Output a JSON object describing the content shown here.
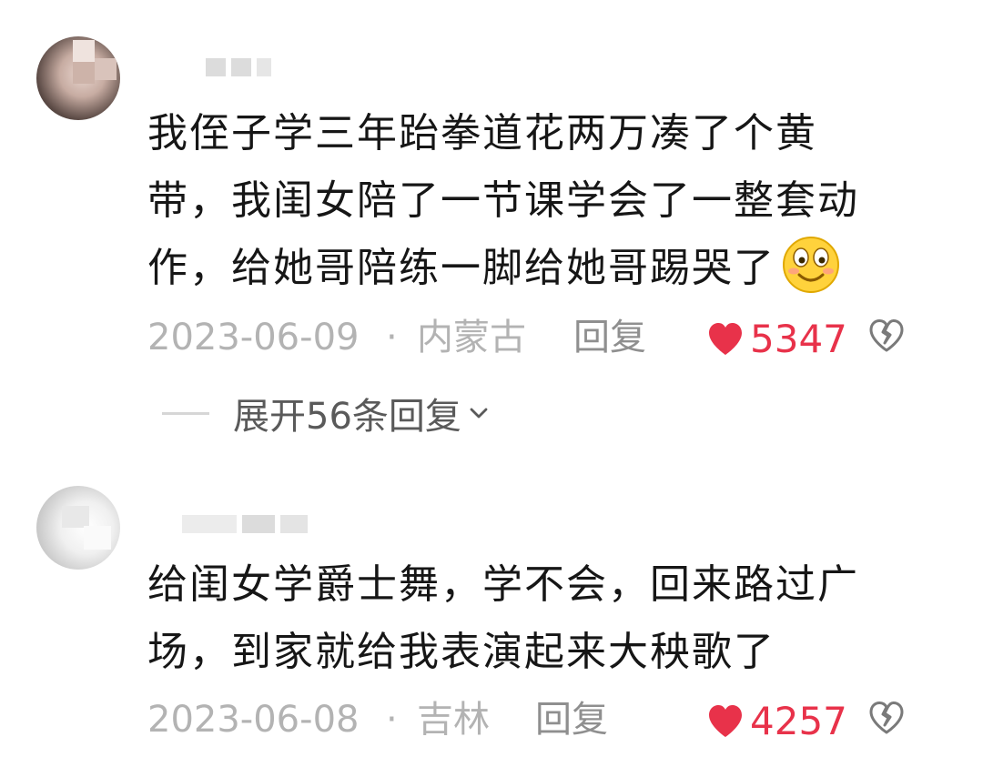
{
  "comments": [
    {
      "text_lines": [
        "我侄子学三年跆拳道花两万凑了个黄",
        "带，我闺女陪了一节课学会了一整套动",
        "作，给她哥陪练一脚给她哥踢哭了"
      ],
      "emoji": "grinning-face-emoji",
      "date": "2023-06-09",
      "separator": "·",
      "location": "内蒙古",
      "reply_label": "回复",
      "likes": "5347",
      "expand_replies": "展开56条回复"
    },
    {
      "text_lines": [
        "给闺女学爵士舞，学不会，回来路过广",
        "场，到家就给我表演起来大秧歌了"
      ],
      "date": "2023-06-08",
      "separator": "·",
      "location": "吉林",
      "reply_label": "回复",
      "likes": "4257"
    }
  ],
  "colors": {
    "like_heart": "#e8324a",
    "meta_text": "#b3b3b3",
    "comment_text": "#161616"
  },
  "icons": [
    "heart-icon",
    "broken-heart-icon",
    "chevron-down-icon",
    "grinning-face-emoji"
  ]
}
